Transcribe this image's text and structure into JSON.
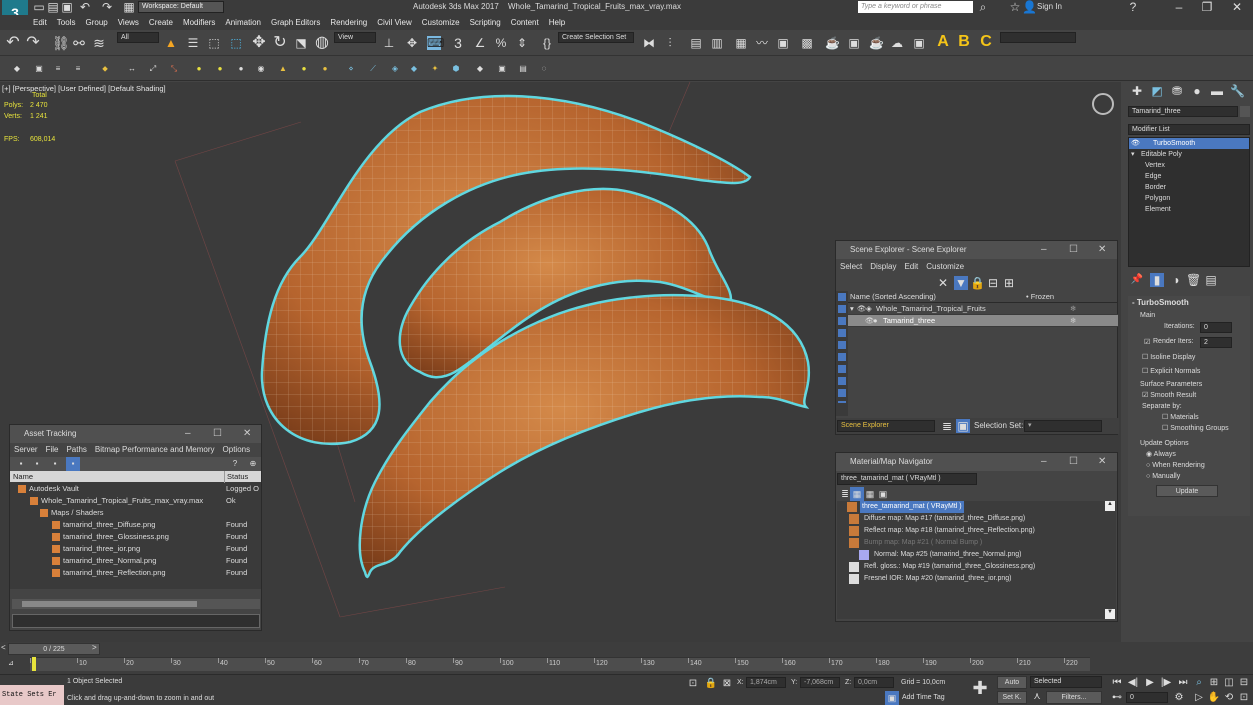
{
  "titlebar": {
    "workspace": "Workspace: Default",
    "app_title": "Autodesk 3ds Max 2017",
    "file_title": "Whole_Tamarind_Tropical_Fruits_max_vray.max",
    "search_placeholder": "Type a keyword or phrase",
    "sign_in": "Sign In"
  },
  "menubar": {
    "items": [
      "Edit",
      "Tools",
      "Group",
      "Views",
      "Create",
      "Modifiers",
      "Animation",
      "Graph Editors",
      "Rendering",
      "Civil View",
      "Customize",
      "Scripting",
      "Content",
      "Help"
    ]
  },
  "toolbar": {
    "filter": "All",
    "view": "View",
    "selection_set": "Create Selection Set"
  },
  "viewport": {
    "label": "[+] [Perspective] [User Defined] [Default Shading]",
    "stats_total": "Total",
    "polys_label": "Polys:",
    "polys": "2 470",
    "verts_label": "Verts:",
    "verts": "1 241",
    "fps_label": "FPS:",
    "fps": "608,014"
  },
  "asset_tracking": {
    "title": "Asset Tracking",
    "menu": [
      "Server",
      "File",
      "Paths",
      "Bitmap Performance and Memory",
      "Options"
    ],
    "col_name": "Name",
    "col_status": "Status",
    "rows": [
      {
        "name": "Autodesk Vault",
        "status": "Logged O"
      },
      {
        "name": "Whole_Tamarind_Tropical_Fruits_max_vray.max",
        "status": "Ok"
      },
      {
        "name": "Maps / Shaders",
        "status": ""
      },
      {
        "name": "tamarind_three_Diffuse.png",
        "status": "Found"
      },
      {
        "name": "tamarind_three_Glossiness.png",
        "status": "Found"
      },
      {
        "name": "tamarind_three_ior.png",
        "status": "Found"
      },
      {
        "name": "tamarind_three_Normal.png",
        "status": "Found"
      },
      {
        "name": "tamarind_three_Reflection.png",
        "status": "Found"
      }
    ]
  },
  "scene_explorer": {
    "title": "Scene Explorer - Scene Explorer",
    "menu": [
      "Select",
      "Display",
      "Edit",
      "Customize"
    ],
    "col_name": "Name (Sorted Ascending)",
    "col_frozen": "• Frozen",
    "rows": [
      "Whole_Tamarind_Tropical_Fruits",
      "Tamarind_three"
    ],
    "footer_label": "Scene Explorer",
    "selection_set": "Selection Set:"
  },
  "material_navigator": {
    "title": "Material/Map Navigator",
    "material": "three_tamarind_mat  ( VRayMtl )",
    "items": [
      "three_tamarind_mat  ( VRayMtl )",
      "Diffuse map: Map #17 (tamarind_three_Diffuse.png)",
      "Reflect map: Map #18 (tamarind_three_Reflection.png)",
      "Bump map: Map #21 ( Normal Bump )",
      "Normal: Map #25 (tamarind_three_Normal.png)",
      "Refl. gloss.: Map #19 (tamarind_three_Glossiness.png)",
      "Fresnel IOR: Map #20 (tamarind_three_ior.png)"
    ]
  },
  "command_panel": {
    "object_name": "Tamarind_three",
    "modifier_list": "Modifier List",
    "stack": [
      "TurboSmooth",
      "Editable Poly",
      "Vertex",
      "Edge",
      "Border",
      "Polygon",
      "Element"
    ],
    "rollout_title": "TurboSmooth",
    "main_label": "Main",
    "iterations_label": "Iterations:",
    "iterations": "0",
    "render_iters_label": "Render Iters:",
    "render_iters": "2",
    "isoline": "Isoline Display",
    "explicit": "Explicit Normals",
    "surface_params": "Surface Parameters",
    "smooth_result": "Smooth Result",
    "separate_by": "Separate by:",
    "materials": "Materials",
    "smoothing_groups": "Smoothing Groups",
    "update_options": "Update Options",
    "always": "Always",
    "when_rendering": "When Rendering",
    "manually": "Manually",
    "update_button": "Update"
  },
  "timeline": {
    "frame": "0 / 225",
    "ticks": [
      "0",
      "10",
      "20",
      "30",
      "40",
      "50",
      "60",
      "70",
      "80",
      "90",
      "100",
      "110",
      "120",
      "130",
      "140",
      "150",
      "160",
      "170",
      "180",
      "190",
      "200",
      "210",
      "220"
    ]
  },
  "statusbar": {
    "script_label": "State Sets Er",
    "selected": "1 Object Selected",
    "hint": "Click and drag up-and-down to zoom in and out",
    "x_label": "X:",
    "x": "1,874cm",
    "y_label": "Y:",
    "y": "-7,068cm",
    "z_label": "Z:",
    "z": "0,0cm",
    "grid": "Grid = 10,0cm",
    "add_time_tag": "Add Time Tag",
    "auto": "Auto",
    "selected_dropdown": "Selected",
    "set_k": "Set K.",
    "filters": "Filters...",
    "frame_input": "0"
  }
}
